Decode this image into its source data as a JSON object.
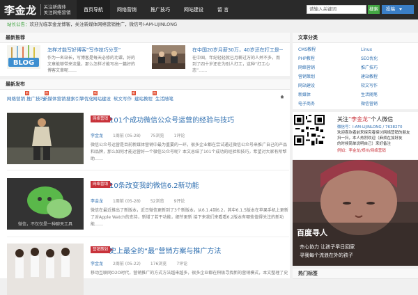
{
  "header": {
    "logo": "李金龙",
    "tagline1": "关注新媒体",
    "tagline2": "关注网络营销",
    "nav": [
      "首页导航",
      "网络营销",
      "推广技巧",
      "网站建设",
      "留 言"
    ],
    "search_placeholder": "请输入关键词",
    "search_button": "搜索",
    "dropdown_button": "投稿"
  },
  "notice": {
    "highlight": "站长公告：",
    "text": "欢迎光临李金龙博客，关注新媒体网络营销推广，微信号I-AM-LIJINLONG"
  },
  "recommend": {
    "heading": "最新推荐",
    "items": [
      {
        "title": "怎样才能写好博客“写作技巧分享”",
        "desc": "作为一名站长，写博客是每天必修的功课，好的文章能够带来流量，那么怎样才能写出一篇好的博客文章呢……"
      },
      {
        "title": "在中国20岁月薪30万，40岁还在打工是一种什么样的体验",
        "desc": "在中国，年纪轻轻就已月薪过万的人并不多，而到了四十岁还在为别人打工，这种“打工心态”……"
      }
    ]
  },
  "latest": {
    "heading": "最新发布",
    "tabs": [
      "网络营销",
      "推广技巧",
      "新媒体营销",
      "搜索引擎优化",
      "网站建设",
      "软文写作",
      "建站教程",
      "生活随笔"
    ],
    "badges": [
      "新",
      "热"
    ]
  },
  "posts": [
    {
      "tag": "网络营销",
      "title": "101个成功微信公众号运营的经验与技巧",
      "author": "李金龙",
      "date": "1周前 (05-28)",
      "views": "75浏览",
      "comments": "1评论",
      "excerpt": "微信公众号运营是目前新媒体营销中最为重要的一环，很多企业都在尝试通过微信公众号来推广自己的产品和品牌，那么如何才能运营好一个微信公众号呢？本文总结了101个成功的经验和技巧，希望对大家有所帮助……"
    },
    {
      "tag": "网络营销",
      "title": "10条改变我的微信6.2新功能",
      "author": "李金龙",
      "date": "1周前 (05-28)",
      "views": "52浏览",
      "comments": "9评论",
      "excerpt": "微信在最近推出了新版本，近日微信更新到了3个新版本，从6.1.4到6.2，其中6.1.5版本在苹果手机上更新了对Apple Watch的支持，新增了若干功能，细节更新 接下来我们来看看6.2版本有哪些值得关注的新功能……",
      "image_caption": "微信，不仅仅是一种聊天工具"
    },
    {
      "tag": "营销策划",
      "title": "史上最全的“最”营销方案与推广方法",
      "author": "李金龙",
      "date": "2周前 (05-22)",
      "views": "176浏览",
      "comments": "7评论",
      "excerpt": "移动互联网O2O时代，营销推广的方式方法越来越多，很多企业都在积极寻找新的营销模式，本文整理了史上最全的营销方案……"
    }
  ],
  "sidebar": {
    "categories_heading": "文章分类",
    "categories": [
      "CMS教程",
      "Linux",
      "PHP教程",
      "SEO优化",
      "网络营销",
      "推广技巧",
      "营销策划",
      "建站教程",
      "网站建设",
      "软文写作",
      "新媒体",
      "生活随笔",
      "电子商务",
      "微信营销"
    ],
    "wechat": {
      "title_pre": "关注",
      "title_name": "“李金龙”",
      "title_post": "个人微信",
      "line1": "微信号：I-AM-LIJINLONG / 7638270",
      "line2": "欢迎喜欢者前来探究者探讨网络营销的朋友",
      "line3": "扫一扫，本人热烈欢迎（麻烦在加好友",
      "line4": "的时候简单说明自己）来好备注",
      "line5": "例如：李金龙/郑州/网络营销"
    },
    "poster": {
      "title": "百度寻人",
      "line1": "齐心协力 让孩子早日回家",
      "line2": "寻我每个流浪在外的孩子"
    },
    "bottom_heading": "热门标签"
  },
  "colors": {
    "header_bg": "#2a2a2a",
    "link": "#2f6fb0",
    "accent_red": "#c8323a",
    "green": "#44a744",
    "blue": "#3a7ec6"
  }
}
